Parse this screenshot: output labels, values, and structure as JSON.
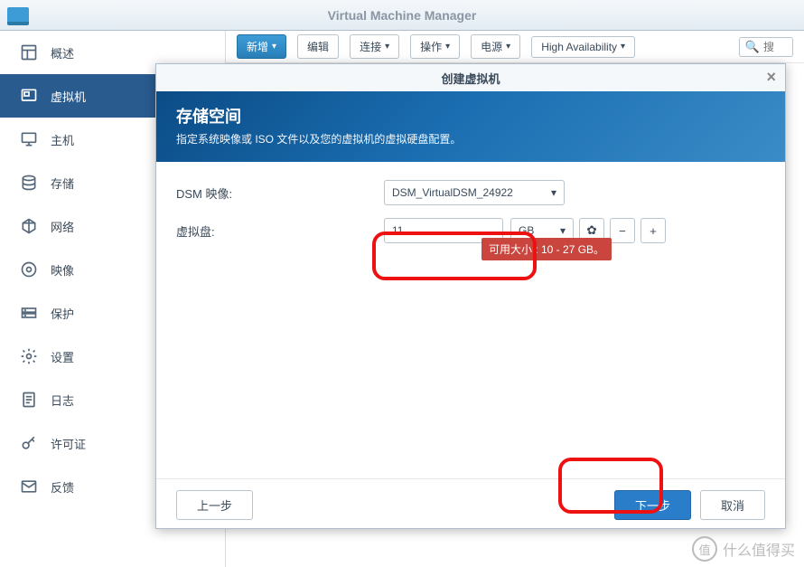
{
  "window": {
    "title": "Virtual Machine Manager"
  },
  "sidebar": {
    "items": [
      {
        "label": "概述",
        "icon": "layout"
      },
      {
        "label": "虚拟机",
        "icon": "vm",
        "active": true
      },
      {
        "label": "主机",
        "icon": "monitor"
      },
      {
        "label": "存储",
        "icon": "disks"
      },
      {
        "label": "网络",
        "icon": "network"
      },
      {
        "label": "映像",
        "icon": "image"
      },
      {
        "label": "保护",
        "icon": "shield"
      },
      {
        "label": "设置",
        "icon": "gear"
      },
      {
        "label": "日志",
        "icon": "log"
      },
      {
        "label": "许可证",
        "icon": "key"
      },
      {
        "label": "反馈",
        "icon": "mail"
      }
    ]
  },
  "toolbar": {
    "add": "新增",
    "edit": "编辑",
    "connect": "连接",
    "action": "操作",
    "power": "电源",
    "ha": "High Availability",
    "search_placeholder": "搜"
  },
  "dialog": {
    "title": "创建虚拟机",
    "banner_title": "存储空间",
    "banner_sub": "指定系统映像或 ISO 文件以及您的虚拟机的虚拟硬盘配置。",
    "dsm_label": "DSM 映像:",
    "dsm_value": "DSM_VirtualDSM_24922",
    "vdisk_label": "虚拟盘:",
    "vdisk_value": "11",
    "vdisk_unit": "GB",
    "hint": "可用大小 : 10 - 27 GB。",
    "back": "上一步",
    "next": "下一步",
    "cancel": "取消"
  },
  "watermark": {
    "text": "什么值得买",
    "mark": "值"
  }
}
